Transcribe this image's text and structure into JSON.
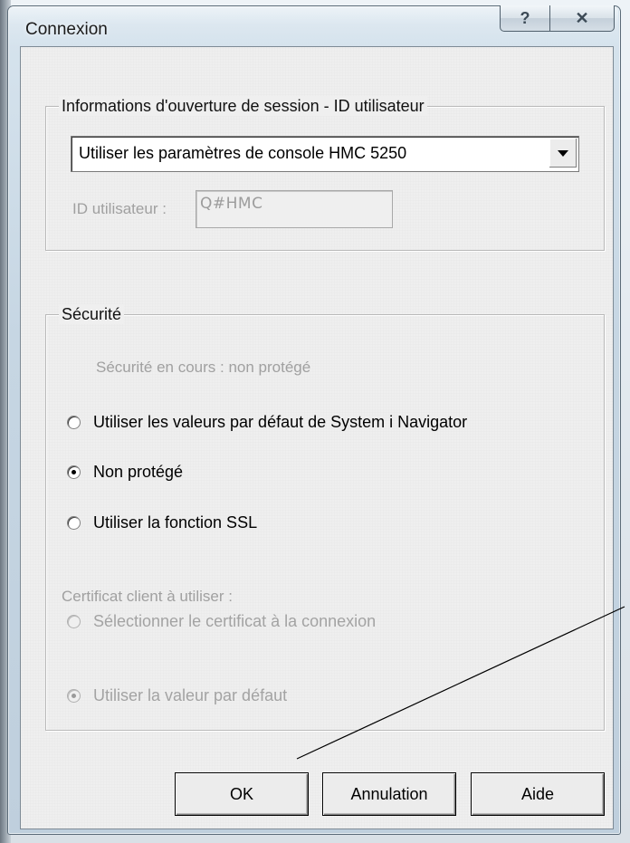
{
  "window": {
    "title": "Connexion",
    "help_glyph": "?",
    "close_glyph": "✕"
  },
  "logon_group": {
    "label": "Informations d'ouverture de session - ID utilisateur",
    "combo_value": "Utiliser les paramètres de console HMC 5250",
    "userid_label": "ID utilisateur :",
    "userid_value": "Q#HMC"
  },
  "security_group": {
    "label": "Sécurité",
    "current_security": "Sécurité en cours : non protégé",
    "options": [
      {
        "label": "Utiliser les valeurs par défaut de System i Navigator",
        "checked": false,
        "enabled": true
      },
      {
        "label": "Non protégé",
        "checked": true,
        "enabled": true
      },
      {
        "label": "Utiliser la fonction SSL",
        "checked": false,
        "enabled": true
      }
    ],
    "cert_label": "Certificat client à utiliser :",
    "cert_options": [
      {
        "label": "Sélectionner le certificat à la connexion",
        "checked": false,
        "enabled": false
      },
      {
        "label": "Utiliser la valeur par défaut",
        "checked": true,
        "enabled": false
      }
    ]
  },
  "buttons": {
    "ok": "OK",
    "cancel": "Annulation",
    "help": "Aide"
  }
}
